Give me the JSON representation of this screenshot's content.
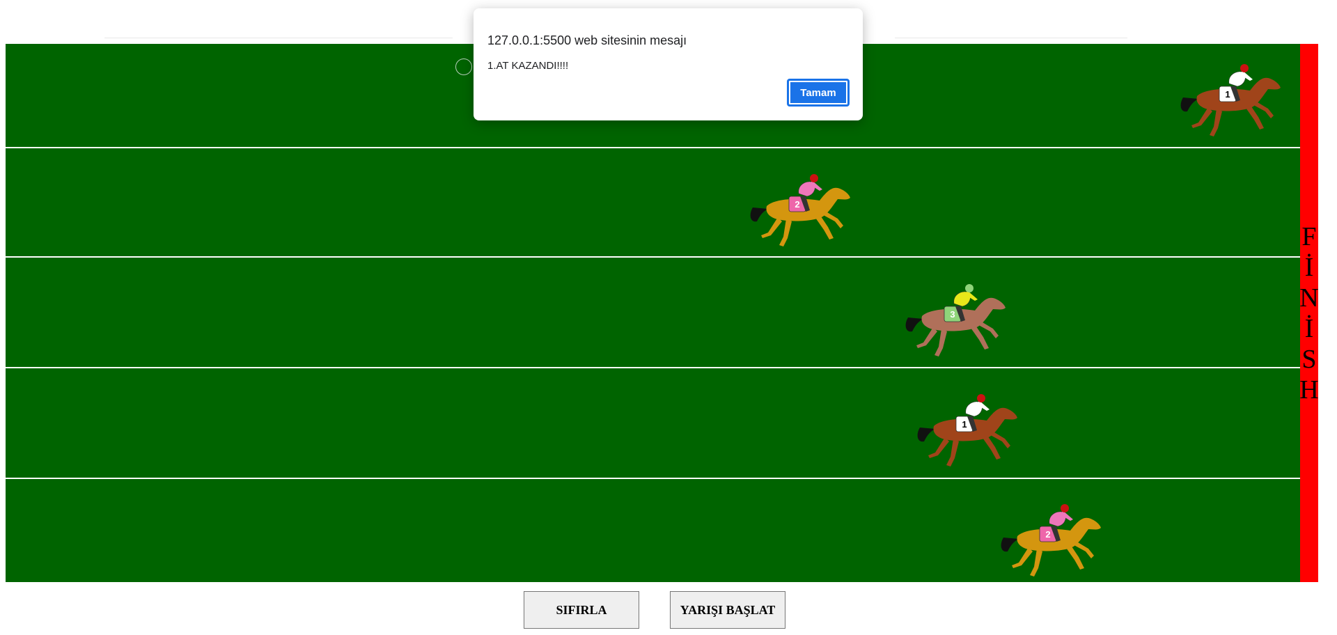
{
  "race": {
    "finish_label": [
      "F",
      "İ",
      "N",
      "İ",
      "S",
      "H"
    ],
    "colors": {
      "track": "#006400",
      "finish": "#ff0000",
      "lane_divider": "#ffffff"
    },
    "horses": [
      {
        "lane": 1,
        "number": "1",
        "silks": "red-white",
        "coat": "chestnut",
        "progress": 0.98
      },
      {
        "lane": 2,
        "number": "2",
        "silks": "pink-red",
        "coat": "palomino",
        "progress": 0.62
      },
      {
        "lane": 3,
        "number": "3",
        "silks": "yellow-green",
        "coat": "bay",
        "progress": 0.75
      },
      {
        "lane": 4,
        "number": "1",
        "silks": "red-white",
        "coat": "chestnut",
        "progress": 0.76
      },
      {
        "lane": 5,
        "number": "2",
        "silks": "pink-red",
        "coat": "palomino",
        "progress": 0.83
      }
    ]
  },
  "controls": {
    "reset_label": "SIFIRLA",
    "start_label": "YARIŞI BAŞLAT"
  },
  "alert": {
    "title": "127.0.0.1:5500 web sitesinin mesajı",
    "message": "1.AT KAZANDI!!!!",
    "ok_label": "Tamam"
  }
}
